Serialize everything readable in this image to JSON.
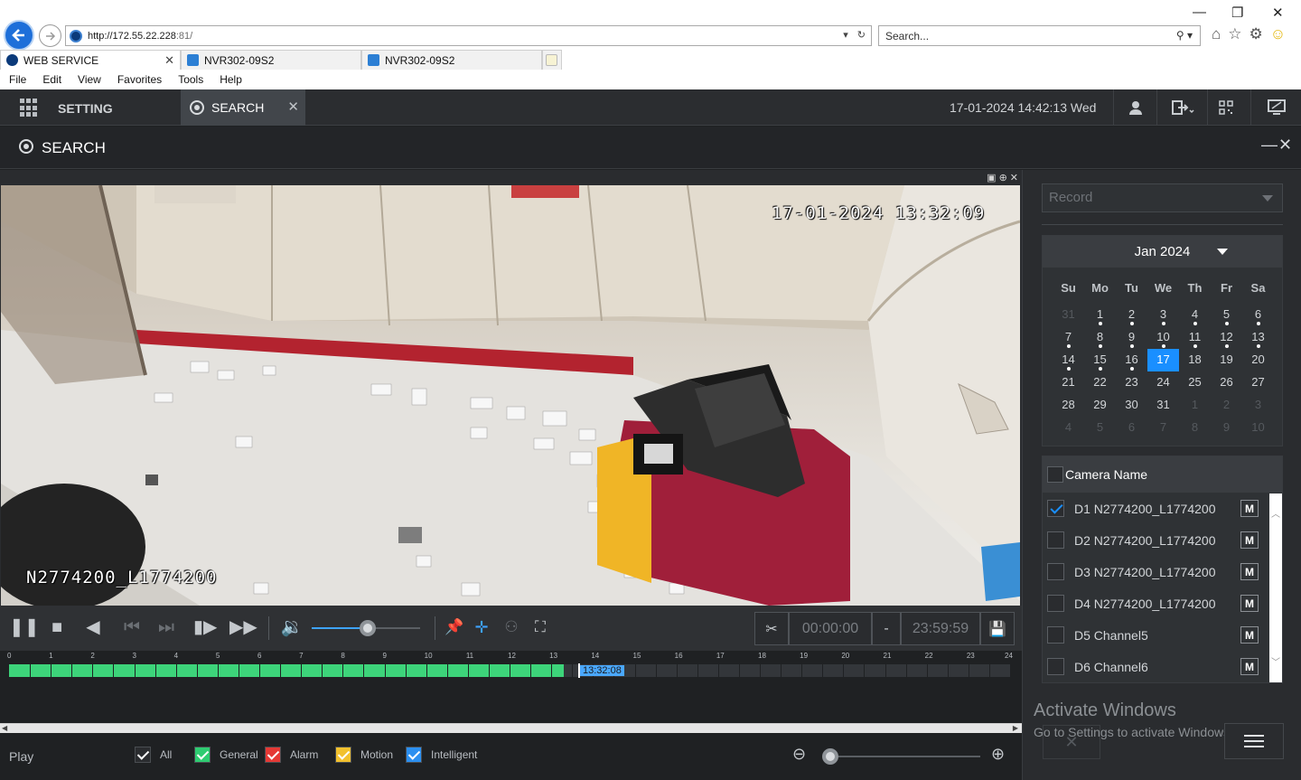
{
  "browser": {
    "url_host": "http://172.55.22.228",
    "url_port": ":81/",
    "search_placeholder": "Search...",
    "tabs": [
      {
        "label": "WEB SERVICE"
      },
      {
        "label": "NVR302-09S2"
      },
      {
        "label": "NVR302-09S2"
      }
    ],
    "menu": [
      "File",
      "Edit",
      "View",
      "Favorites",
      "Tools",
      "Help"
    ]
  },
  "header": {
    "setting_label": "SETTING",
    "search_tab_label": "SEARCH",
    "datetime": "17-01-2024 14:42:13 Wed"
  },
  "page": {
    "title": "SEARCH"
  },
  "video": {
    "osd_time": "17-01-2024 13:32:09",
    "osd_name": "N2774200_L1774200"
  },
  "player": {
    "clip_start": "00:00:00",
    "clip_sep": "-",
    "clip_end": "23:59:59",
    "volume_level": 0.52
  },
  "timeline": {
    "hours": [
      "0",
      "1",
      "2",
      "3",
      "4",
      "5",
      "6",
      "7",
      "8",
      "9",
      "10",
      "11",
      "12",
      "13",
      "14",
      "15",
      "16",
      "17",
      "18",
      "19",
      "20",
      "21",
      "22",
      "23",
      "24"
    ],
    "current_time": "13:32:08",
    "recorded_until_hour": 13.3
  },
  "bottom": {
    "play_label": "Play",
    "filters": [
      {
        "label": "All",
        "color": "#2a2c2f"
      },
      {
        "label": "General",
        "color": "#2ecc71"
      },
      {
        "label": "Alarm",
        "color": "#e53935"
      },
      {
        "label": "Motion",
        "color": "#f2c12e"
      },
      {
        "label": "Intelligent",
        "color": "#2b8ff0"
      }
    ]
  },
  "right_panel": {
    "record_select": "Record",
    "calendar": {
      "month_label": "Jan 2024",
      "weekdays": [
        "Su",
        "Mo",
        "Tu",
        "We",
        "Th",
        "Fr",
        "Sa"
      ],
      "days": [
        {
          "d": "31",
          "state": "dim"
        },
        {
          "d": "1",
          "state": "rec"
        },
        {
          "d": "2",
          "state": "rec"
        },
        {
          "d": "3",
          "state": "rec"
        },
        {
          "d": "4",
          "state": "rec"
        },
        {
          "d": "5",
          "state": "rec"
        },
        {
          "d": "6",
          "state": "rec"
        },
        {
          "d": "7",
          "state": "rec"
        },
        {
          "d": "8",
          "state": "rec"
        },
        {
          "d": "9",
          "state": "rec"
        },
        {
          "d": "10",
          "state": "rec"
        },
        {
          "d": "11",
          "state": "rec"
        },
        {
          "d": "12",
          "state": "rec"
        },
        {
          "d": "13",
          "state": "rec"
        },
        {
          "d": "14",
          "state": "rec"
        },
        {
          "d": "15",
          "state": "rec"
        },
        {
          "d": "16",
          "state": "rec"
        },
        {
          "d": "17",
          "state": "sel"
        },
        {
          "d": "18",
          "state": ""
        },
        {
          "d": "19",
          "state": ""
        },
        {
          "d": "20",
          "state": ""
        },
        {
          "d": "21",
          "state": ""
        },
        {
          "d": "22",
          "state": ""
        },
        {
          "d": "23",
          "state": ""
        },
        {
          "d": "24",
          "state": ""
        },
        {
          "d": "25",
          "state": ""
        },
        {
          "d": "26",
          "state": ""
        },
        {
          "d": "27",
          "state": ""
        },
        {
          "d": "28",
          "state": ""
        },
        {
          "d": "29",
          "state": ""
        },
        {
          "d": "30",
          "state": ""
        },
        {
          "d": "31",
          "state": ""
        },
        {
          "d": "1",
          "state": "dim"
        },
        {
          "d": "2",
          "state": "dim"
        },
        {
          "d": "3",
          "state": "dim"
        },
        {
          "d": "4",
          "state": "dim"
        },
        {
          "d": "5",
          "state": "dim"
        },
        {
          "d": "6",
          "state": "dim"
        },
        {
          "d": "7",
          "state": "dim"
        },
        {
          "d": "8",
          "state": "dim"
        },
        {
          "d": "9",
          "state": "dim"
        },
        {
          "d": "10",
          "state": "dim"
        }
      ]
    },
    "camera_header": "Camera Name",
    "cameras": [
      {
        "name": "D1 N2774200_L1774200",
        "checked": true
      },
      {
        "name": "D2 N2774200_L1774200",
        "checked": false
      },
      {
        "name": "D3 N2774200_L1774200",
        "checked": false
      },
      {
        "name": "D4 N2774200_L1774200",
        "checked": false
      },
      {
        "name": "D5 Channel5",
        "checked": false
      },
      {
        "name": "D6 Channel6",
        "checked": false
      }
    ],
    "m_label": "M",
    "activate_line1": "Activate Windows",
    "activate_line2": "Go to Settings to activate Windows."
  }
}
